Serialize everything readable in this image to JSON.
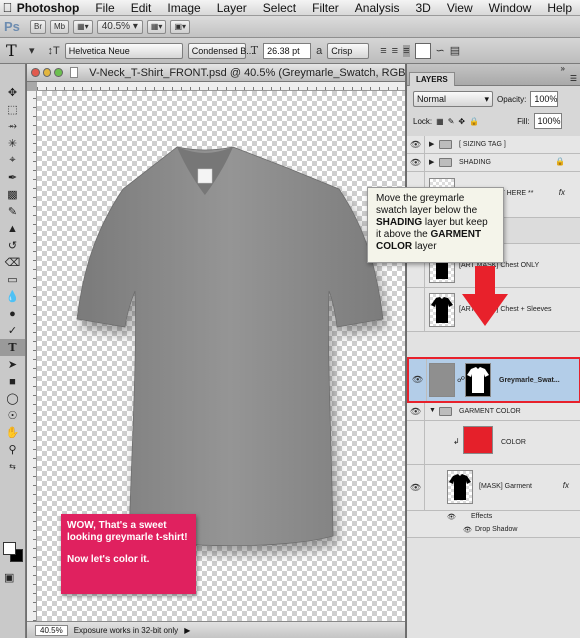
{
  "menubar": {
    "app": "Photoshop",
    "items": [
      "File",
      "Edit",
      "Image",
      "Layer",
      "Select",
      "Filter",
      "Analysis",
      "3D",
      "View",
      "Window",
      "Help"
    ]
  },
  "appbar": {
    "logo": "Ps",
    "buttons": [
      "Br",
      "Mb"
    ],
    "zoom": "40.5%"
  },
  "options": {
    "font_family": "Helvetica Neue",
    "font_style": "Condensed B...",
    "font_size": "26.38 pt",
    "aa_label": "a",
    "antialias": "Crisp"
  },
  "document": {
    "title": "V-Neck_T-Shirt_FRONT.psd @ 40.5% (Greymarle_Swatch, RGB/8) *",
    "status_zoom": "40.5%",
    "status_text": "Exposure works in 32-bit only"
  },
  "callout_pink": {
    "line1": "WOW, That's a sweet looking greymarle t-shirt!",
    "line2": "Now let's color it."
  },
  "tooltip": {
    "part1": "Move the greymarle swatch layer below the",
    "bold1": "SHADING",
    "part2": "layer but keep it above the",
    "bold2": "GARMENT COLOR",
    "part3": "layer"
  },
  "panel": {
    "tab": "LAYERS",
    "blend_mode": "Normal",
    "opacity_label": "Opacity:",
    "opacity": "100%",
    "lock_label": "Lock:",
    "fill_label": "Fill:",
    "fill": "100%"
  },
  "layers": [
    {
      "name": "[ SIZING TAG ]"
    },
    {
      "name": "SHADING"
    },
    {
      "name": "** PLACE ART HERE **"
    },
    {
      "name": "[ART MASK] Chest ONLY"
    },
    {
      "name": "[ART MASK] Chest + Sleeves"
    },
    {
      "name": "Greymarle_Swat..."
    },
    {
      "name": "GARMENT COLOR"
    },
    {
      "name": "COLOR"
    },
    {
      "name": "[MASK] Garment"
    },
    {
      "name": "Effects"
    },
    {
      "name": "Drop Shadow"
    }
  ],
  "colors": {
    "accent_red": "#e8212b",
    "callout_pink": "#e0215f",
    "selected_layer": "#b3cde8",
    "shirt_grey": "#8a8a8a",
    "color_fill": "#e5202a"
  }
}
